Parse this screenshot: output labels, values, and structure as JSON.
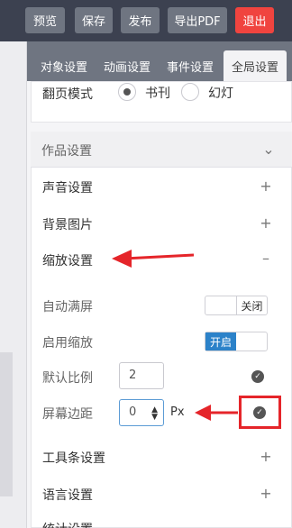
{
  "toolbar": {
    "preview": "预览",
    "save": "保存",
    "publish": "发布",
    "export_pdf": "导出PDF",
    "exit": "退出"
  },
  "tabs": [
    "对象设置",
    "动画设置",
    "事件设置",
    "全局设置"
  ],
  "active_tab": "全局设置",
  "page_mode": {
    "label": "翻页模式",
    "options": [
      "书刊",
      "幻灯"
    ],
    "selected": "书刊"
  },
  "sections": {
    "works": "作品设置",
    "sound": "声音设置",
    "background": "背景图片",
    "zoom": "缩放设置",
    "toolbar": "工具条设置",
    "language": "语言设置",
    "partial": "统计设置"
  },
  "zoom": {
    "auto_fullscreen": {
      "label": "自动满屏",
      "state_text": "关闭"
    },
    "enable_zoom": {
      "label": "启用缩放",
      "state_text": "开启"
    },
    "default_ratio": {
      "label": "默认比例",
      "value": "2"
    },
    "screen_margin": {
      "label": "屏幕边距",
      "value": "0",
      "unit": "Px"
    }
  },
  "colors": {
    "topbar": "#3c4150",
    "button": "#6f7581",
    "exit": "#f0443f",
    "toggle_on": "#2c82c9",
    "annotation": "#e5252a"
  }
}
